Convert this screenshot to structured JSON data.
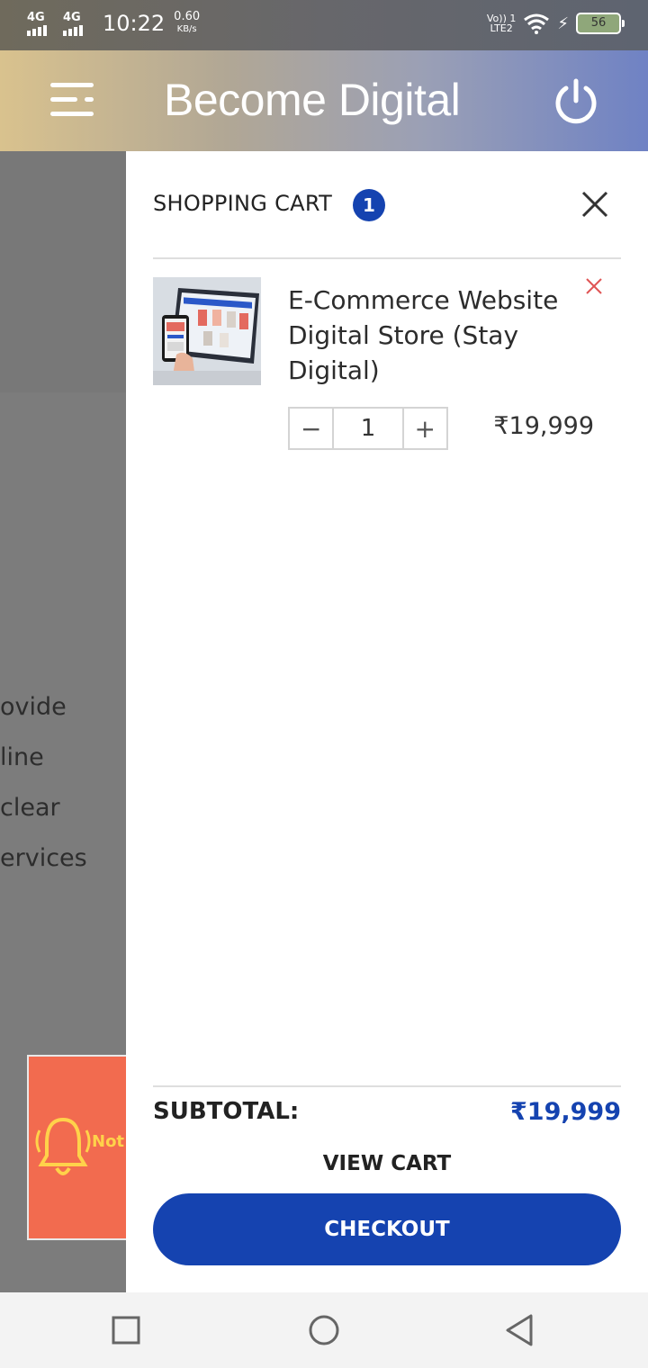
{
  "status_bar": {
    "network1": "4G",
    "network2": "4G",
    "time": "10:22",
    "speed_value": "0.60",
    "speed_unit": "KB/s",
    "volte": "Vo)) 1",
    "lte": "LTE2",
    "battery": "56"
  },
  "header": {
    "title": "Become Digital",
    "menu_icon": "menu-icon",
    "power_icon": "power-icon"
  },
  "background_page": {
    "lines": [
      "ovide",
      "line",
      "clear",
      "ervices"
    ],
    "notification_banner_text": "Not"
  },
  "cart": {
    "title": "SHOPPING CART",
    "count": "1",
    "items": [
      {
        "name": "E-Commerce Website Digital Store (Stay Digital)",
        "quantity": "1",
        "decrement_symbol": "−",
        "increment_symbol": "+",
        "price": "₹19,999"
      }
    ],
    "subtotal_label": "SUBTOTAL:",
    "subtotal_value": "₹19,999",
    "view_cart_label": "VIEW CART",
    "checkout_label": "CHECKOUT"
  },
  "colors": {
    "accent": "#1543b0",
    "remove": "#e05555"
  }
}
